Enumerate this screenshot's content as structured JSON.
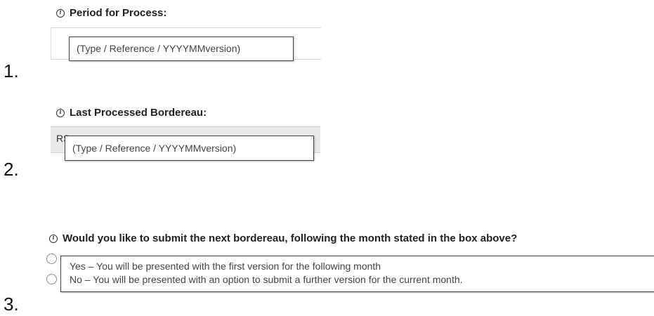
{
  "items": [
    {
      "number": "1.",
      "label": "Period for Process:",
      "tooltip": "(Type / Reference / YYYYMMversion)"
    },
    {
      "number": "2.",
      "label": "Last Processed Bordereau:",
      "field_value": "RS",
      "tooltip": "(Type / Reference / YYYYMMversion)"
    },
    {
      "number": "3.",
      "label": "Would you like to submit the next bordereau, following the month stated in the box above?",
      "options": [
        "Yes – You will be presented with the first version for the following month",
        "No – You will be presented with an option to submit a further version for the current month."
      ]
    }
  ],
  "icons": {
    "info": "info-icon",
    "radio": "radio-button"
  }
}
